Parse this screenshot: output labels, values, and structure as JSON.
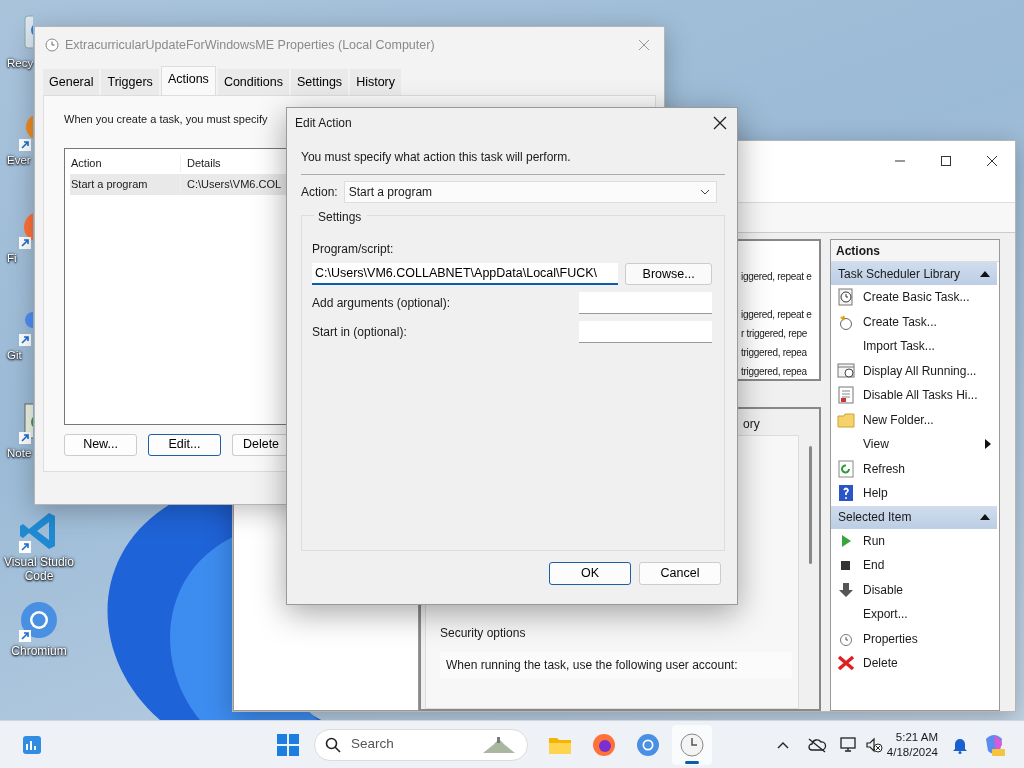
{
  "desktop_icons": [
    {
      "label": "Recy"
    },
    {
      "label": "Ever"
    },
    {
      "label": "Fi"
    },
    {
      "label": "Git"
    },
    {
      "label": "Note"
    },
    {
      "label": "Visual Studio Code"
    },
    {
      "label": "Chromium"
    }
  ],
  "task_scheduler": {
    "task_rows": [
      "iggered, repeat e",
      "iggered, repeat e",
      "r triggered, repe",
      "triggered, repea",
      "triggered, repea"
    ],
    "history_tab": "ory",
    "security_options": {
      "title": "Security options",
      "text": "When running the task, use the following user account:"
    },
    "actions_pane": {
      "title": "Actions",
      "sections": [
        {
          "title": "Task Scheduler Library",
          "expanded": true,
          "items": [
            {
              "label": "Create Basic Task...",
              "submenu": false
            },
            {
              "label": "Create Task...",
              "submenu": false
            },
            {
              "label": "Import Task...",
              "submenu": false
            },
            {
              "label": "Display All Running...",
              "submenu": false
            },
            {
              "label": "Disable All Tasks Hi...",
              "submenu": false
            },
            {
              "label": "New Folder...",
              "submenu": false
            },
            {
              "label": "View",
              "submenu": true
            },
            {
              "label": "Refresh",
              "submenu": false
            },
            {
              "label": "Help",
              "submenu": false
            }
          ]
        },
        {
          "title": "Selected Item",
          "expanded": true,
          "items": [
            {
              "label": "Run",
              "submenu": false
            },
            {
              "label": "End",
              "submenu": false
            },
            {
              "label": "Disable",
              "submenu": false
            },
            {
              "label": "Export...",
              "submenu": false
            },
            {
              "label": "Properties",
              "submenu": false
            },
            {
              "label": "Delete",
              "submenu": false
            }
          ]
        }
      ]
    }
  },
  "properties_window": {
    "title": "ExtracurricularUpdateForWindowsME Properties (Local Computer)",
    "tabs": [
      {
        "label": "General",
        "selected": false
      },
      {
        "label": "Triggers",
        "selected": false
      },
      {
        "label": "Actions",
        "selected": true
      },
      {
        "label": "Conditions",
        "selected": false
      },
      {
        "label": "Settings",
        "selected": false
      },
      {
        "label": "History",
        "selected": false
      }
    ],
    "description": "When you create a task, you must specify",
    "table": {
      "columns": [
        "Action",
        "Details"
      ],
      "rows": [
        {
          "cells": [
            "Start a program",
            "C:\\Users\\VM6.COL"
          ],
          "selected": true
        }
      ]
    },
    "buttons": [
      {
        "label": "New...",
        "focused": false
      },
      {
        "label": "Edit...",
        "focused": true
      },
      {
        "label": "Delete",
        "focused": false
      }
    ]
  },
  "edit_action": {
    "title": "Edit Action",
    "instruction": "You must specify what action this task will perform.",
    "action": {
      "label": "Action:",
      "value": "Start a program"
    },
    "settings": {
      "title": "Settings",
      "program": {
        "label": "Program/script:",
        "value": "C:\\Users\\VM6.COLLABNET\\AppData\\Local\\FUCK\\",
        "focused": true
      },
      "browse": "Browse...",
      "arguments": {
        "label": "Add arguments (optional):"
      },
      "start_in": {
        "label": "Start in (optional):"
      }
    },
    "buttons": [
      {
        "label": "OK",
        "default": true
      },
      {
        "label": "Cancel",
        "default": false
      }
    ]
  },
  "taskbar": {
    "search": {
      "placeholder": "Search"
    },
    "apps": [
      {
        "selected": false
      },
      {
        "selected": false
      },
      {
        "selected": false
      },
      {
        "selected": true
      }
    ],
    "time": "5:21 AM",
    "date": "4/18/2024"
  }
}
